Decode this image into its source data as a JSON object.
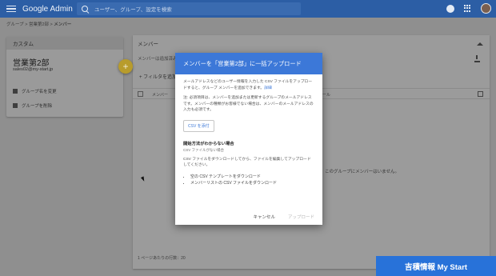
{
  "header": {
    "brand": "Google Admin",
    "search_placeholder": "ユーザー、グループ、設定を検索"
  },
  "breadcrumb": {
    "groups": "グループ",
    "sep1": " > ",
    "group": "営業第2部",
    "sep2": " > ",
    "current": "メンバー"
  },
  "group_card": {
    "tag": "カスタム",
    "name": "営業第2部",
    "email": "sales02@my-start.jp",
    "actions": [
      {
        "label": "グループ名を変更"
      },
      {
        "label": "グループを削除"
      }
    ]
  },
  "members_panel": {
    "title": "メンバー",
    "subtitle": "メンバーは追加済みです",
    "filter_label": "+ フィルタを追加",
    "col_member": "メンバー",
    "col_role": "ロール",
    "empty_message": "このグループにメンバーはいません。",
    "pager": "1 ページあたりの行数：20"
  },
  "dialog": {
    "title": "メンバーを「営業第2部」に一括アップロード",
    "intro": "メールアドレスなどのユーザー情報を入力した CSV ファイルをアップロードすると、グループ メンバーを追加できます。",
    "intro_link": "詳細",
    "note": "注: 必須項目は、メンバーを追加または更新するグループのメールアドレスです。メンバーの種類がお客様でない場合は、メンバーのメールアドレスの入力も必須です。",
    "attach_button": "CSV を添付",
    "help_heading": "開始方法がわからない場合",
    "help_sub": "CSV ファイルがない場合",
    "help_text": "CSV ファイルをダウンロードしてから、ファイルを編集してアップロードしてください。",
    "links": [
      {
        "label": "空の CSV テンプレートをダウンロード"
      },
      {
        "label": "メンバーリストの CSV ファイルをダウンロード"
      }
    ],
    "cancel": "キャンセル",
    "upload": "アップロード"
  },
  "watermark": "吉積情報 My Start"
}
